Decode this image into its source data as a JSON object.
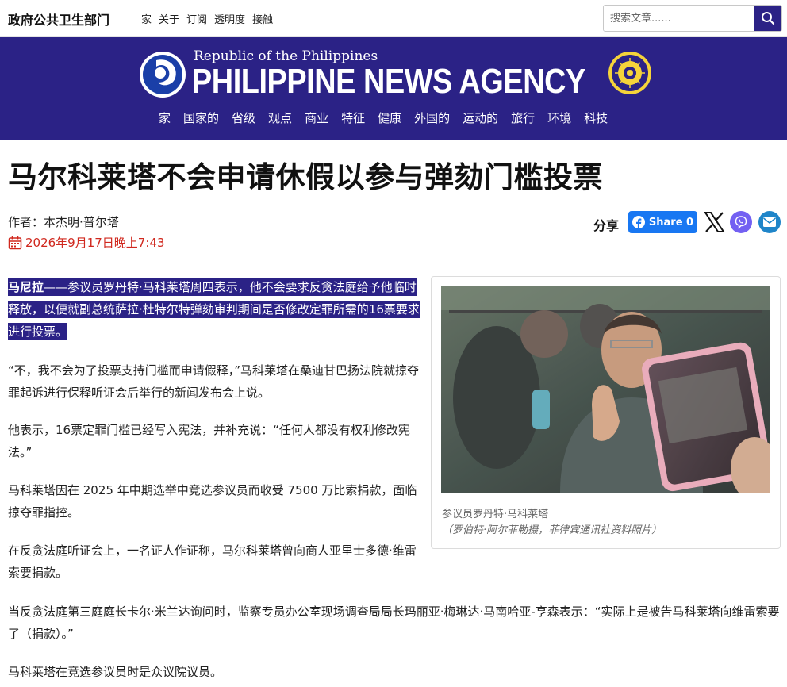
{
  "topbar": {
    "site_name": "政府公共卫生部门",
    "nav": [
      "家",
      "关于",
      "订阅",
      "透明度",
      "接触"
    ],
    "search_placeholder": "搜索文章......"
  },
  "banner": {
    "republic_text": "Republic of the Philippines",
    "agency_name": "PHILIPPINE NEWS AGENCY",
    "main_nav": [
      "家",
      "国家的",
      "省级",
      "观点",
      "商业",
      "特征",
      "健康",
      "外国的",
      "运动的",
      "旅行",
      "环境",
      "科技"
    ],
    "background_color": "#2b2286"
  },
  "article": {
    "headline": "马尔科莱塔不会申请休假以参与弹劾门槛投票",
    "author": "作者：本杰明·普尔塔",
    "date": "2026年9月17日晚上7:43",
    "share_label": "分享",
    "fb_share_label": "Share 0",
    "lead_place": "马尼拉",
    "lead_text": "——参议员罗丹特·马科莱塔周四表示，他不会要求反贪法庭给予他临时释放，以便就副总统萨拉·杜特尔特弹劾审判期间是否修改定罪所需的16票要求进行投票。",
    "paragraphs": [
      "“不，我不会为了投票支持门槛而申请假释，”马科莱塔在桑迪甘巴扬法院就掠夺罪起诉进行保释听证会后举行的新闻发布会上说。",
      "他表示，16票定罪门槛已经写入宪法，并补充说：“任何人都没有权利修改宪法。”",
      "马科莱塔因在 2025 年中期选举中竞选参议员而收受 7500 万比索捐款，面临掠夺罪指控。",
      "在反贪法庭听证会上，一名证人作证称，马尔科莱塔曾向商人亚里士多德·维雷索要捐款。",
      "当反贪法庭第三庭庭长卡尔·米兰达询问时，监察专员办公室现场调查局局长玛丽亚·梅琳达·马南哈亚-亨森表示：“实际上是被告马科莱塔向维雷索要了（捐款）。”",
      "马科莱塔在竞选参议员时是众议院议员。"
    ],
    "photo_caption_name": "参议员罗丹特·马科莱塔",
    "photo_caption_credit": "（罗伯特·阿尔菲勒摄，菲律宾通讯社资料照片）"
  },
  "icons": [
    "search-icon",
    "pna-logo",
    "seal-logo",
    "calendar-icon",
    "facebook-icon",
    "x-icon",
    "viber-icon",
    "email-icon"
  ],
  "colors": {
    "accent": "#2b2286",
    "date": "#d0281e",
    "facebook": "#1877f2",
    "viber": "#7360f2",
    "email": "#1f85c9"
  }
}
